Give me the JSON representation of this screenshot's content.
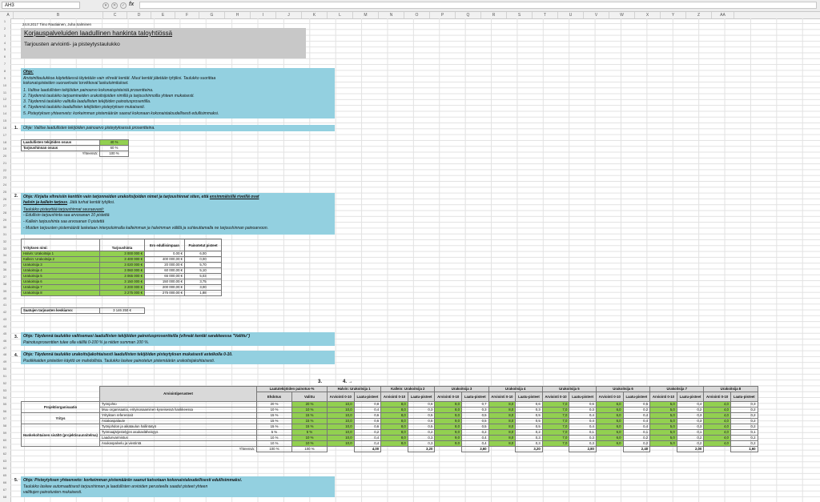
{
  "formula_bar": {
    "cell_ref": "AH3",
    "fx_label": "fx",
    "formula": ""
  },
  "column_letters": [
    "A",
    "B",
    "C",
    "D",
    "E",
    "F",
    "G",
    "H",
    "I",
    "J",
    "K",
    "L",
    "M",
    "N",
    "O",
    "P",
    "Q",
    "R",
    "S",
    "T",
    "U",
    "V",
    "W",
    "X",
    "Y",
    "Z",
    "AA"
  ],
  "row_numbers": [
    "1",
    "2",
    "3",
    "4",
    "5",
    "6",
    "7",
    "8",
    "9",
    "10",
    "11",
    "12",
    "13",
    "14",
    "15",
    "16",
    "17",
    "18",
    "19",
    "20",
    "21",
    "22",
    "23",
    "24",
    "25",
    "26",
    "27",
    "28",
    "29",
    "30",
    "31",
    "32",
    "33",
    "34",
    "35",
    "36",
    "37",
    "38",
    "39",
    "40",
    "41",
    "42",
    "43",
    "44",
    "45",
    "46",
    "47",
    "48",
    "49",
    "50",
    "51",
    "52",
    "53",
    "54",
    "55",
    "56",
    "57",
    "58",
    "59",
    "60",
    "61",
    "62",
    "63",
    "64",
    "65",
    "66",
    "67",
    "68"
  ],
  "doc": {
    "author_line": "24.8.2017 Timo Rautiainen, Juha Salminen",
    "title": "Korjauspalveluiden laadullinen hankinta taloyhtiössä",
    "subtitle": "Tarjousten arviointi- ja pisteytystaulukko"
  },
  "instructions": {
    "heading": "Ohje:",
    "line1": "Arviointitaulukkoa käytettäessä täytetään vain vihreät kentät. Muut kentät jätetään tyhjiksi. Taulukko suorittaa",
    "line2": "kokonaispisteiden suoraviivaisi torvikkoval laskutoimitukset.",
    "steps": [
      "1. Valitse laadullisten tekijöiden painoarvo kokonaispisteistä prosentteina.",
      "2. Täydennä taulukko tarjoamineiden urakoitsijoiden nimillä ja tarjoushinnoilla yhteen mukaisesti.",
      "3. Täydennä taulukko valitulla laadullisten tekijöiden painotusprosentilla.",
      "4. Täydennä taulukko laadullisten tekijöiden pisteytyksen mukaisesti.",
      "5. Pisteytyksen yhteenveto: korkeimman pistemäärän saanut kokonaan kokonaistaloudellisesti edullisimmaksi."
    ]
  },
  "section1": {
    "number": "1.",
    "text": "Ohje: Valitse laadullisten tekijöiden painoarvo pisteytyksessä prosentteina.",
    "rows": [
      {
        "label": "Laadullisten tekijöiden osuus",
        "value": "40 %"
      },
      {
        "label": "Tarjoushinnan osuus",
        "value": "60 %"
      },
      {
        "label": "Yhteensä:",
        "value": "100 %"
      }
    ]
  },
  "section2": {
    "number": "2.",
    "text1a": "Ohje: Kirjaita vihreisiin kenttiin vain tarjonneiden urakoitsijoiden nimet ja tarjoushinnat siten, että ",
    "text1b": "ensimmäisillä riveillä ovat",
    "text2a": "halvin ja kallein tarjous",
    "text2b": ". Jätä turhat kentät tyhjiksi.",
    "rules_heading": "Taulukko pisteyttää tarjoushinnat seuraavasti:",
    "rules": [
      "- Edullisin tarjoushinta saa arvosanan 10 pistettä",
      "- Kallein tarjoushinta saa arvosanan 0 pistettä",
      "- Muiden tarjousten pistemäärät lasketaan interpoloimalla kalleimman ja halvimman välillä ja suhteuttamalla ne tarjoushinnan painoarvoon."
    ],
    "headers": [
      "Yrityksen nimi:",
      "Tarjoushinta",
      "Ero edullisimpaan",
      "Painotetut pisteet"
    ],
    "rows": [
      [
        "Halvin: Urakoitsija 1",
        "3 000 000 €",
        "0,00 €",
        "6,00"
      ],
      [
        "Kallein: Urakoitsija 2",
        "3 400 000 €",
        "400 000,00 €",
        "0,00"
      ],
      [
        "Urakoitsija 3",
        "3 020 000 €",
        "20 000,00 €",
        "5,70"
      ],
      [
        "Urakoitsija 4",
        "3 060 000 €",
        "60 000,00 €",
        "5,10"
      ],
      [
        "Urakoitsija 5",
        "3 065 000 €",
        "65 000,00 €",
        "5,03"
      ],
      [
        "Urakoitsija 6",
        "3 150 000 €",
        "150 000,00 €",
        "3,75"
      ],
      [
        "Urakoitsija 7",
        "3 200 000 €",
        "200 000,00 €",
        "3,00"
      ],
      [
        "Urakoitsija 8",
        "3 275 000 €",
        "275 000,00 €",
        "1,88"
      ]
    ],
    "average_label": "Saatujen tarjousten keskiarvo:",
    "average_value": "3 146 250 €"
  },
  "section3": {
    "number": "3.",
    "text1": "Ohje: Täydennä taulukko valitsemasi laadullisten tekijöiden painotusprosentteilla (vihreät kentät sarakkeessa \"Valittu\")",
    "text2": "Painotusprosenttien tulee olla välillä 0-100 % ja niiden summan 100 %."
  },
  "section4": {
    "number": "4.",
    "text1": "Ohje: Täydennä taulukko urakoitsijakohtaisesti laadullisten tekijöiden pisteytyksen mukaisesti asteikolla 0-10.",
    "text2": "Puolikkaiden pisteiden käyttö on mahdollista. Taulukko laskee painotetun pistemäärän urakoitsijakohtaisesti."
  },
  "matrix": {
    "marker3": "3.",
    "marker4": "4. →",
    "crit_header": "Arviointiperusteet",
    "weights_header": "Laatutekijöiden painotus-%",
    "suggest_label": "Ehdotus",
    "chosen_label": "Valittu",
    "score_label": "Arviointi 0-10",
    "points_label": "Laatu-pisteet",
    "contractors": [
      "Halvin: Urakoitsija 1",
      "Kallein: Urakoitsija 2",
      "Urakoitsija 3",
      "Urakoitsija 4",
      "Urakoitsija 5",
      "Urakoitsija 6",
      "Urakoitsija 7",
      "Urakoitsija 8"
    ],
    "groups": [
      {
        "name": "Projektiorganisaatio",
        "span": 2
      },
      {
        "name": "Yritys",
        "span": 2
      },
      {
        "name": "Hankekohtainen sisältö (projektisuunnitelma)",
        "span": 4
      }
    ],
    "rows": [
      {
        "crit": "Työnjohto",
        "sug": "20 %",
        "sel": "20 %",
        "scores": [
          "10,0",
          "8,0",
          "9,0",
          "8,0",
          "7,0",
          "6,0",
          "5,0",
          "4,0"
        ],
        "pts": [
          "0,8",
          "0,6",
          "0,7",
          "0,6",
          "0,6",
          "0,5",
          "0,4",
          "0,3"
        ]
      },
      {
        "crit": "Muu organisaatio, erityisosaaminen kyseisessä hankkeessa",
        "sug": "10 %",
        "sel": "10 %",
        "scores": [
          "10,0",
          "8,0",
          "8,0",
          "8,0",
          "7,0",
          "6,0",
          "5,0",
          "4,0"
        ],
        "pts": [
          "0,4",
          "0,3",
          "0,3",
          "0,3",
          "0,3",
          "0,2",
          "0,2",
          "0,2"
        ]
      },
      {
        "crit": "Yrityksen referenssit",
        "sug": "15 %",
        "sel": "15 %",
        "scores": [
          "10,0",
          "8,0",
          "9,0",
          "8,0",
          "7,0",
          "6,0",
          "5,0",
          "4,0"
        ],
        "pts": [
          "0,6",
          "0,5",
          "0,5",
          "0,5",
          "0,4",
          "0,4",
          "0,3",
          "0,2"
        ]
      },
      {
        "crit": "Asiakaspalaute",
        "sug": "15 %",
        "sel": "15 %",
        "scores": [
          "10,0",
          "8,0",
          "9,0",
          "8,0",
          "7,0",
          "6,0",
          "5,0",
          "4,0"
        ],
        "pts": [
          "0,6",
          "0,5",
          "0,5",
          "0,5",
          "0,4",
          "0,4",
          "0,3",
          "0,2"
        ]
      },
      {
        "crit": "Työnjohdon ja aikataulun hallintatyö",
        "sug": "15 %",
        "sel": "15 %",
        "scores": [
          "10,0",
          "8,0",
          "8,0",
          "8,0",
          "7,0",
          "6,0",
          "5,0",
          "4,0"
        ],
        "pts": [
          "0,6",
          "0,5",
          "0,5",
          "0,5",
          "0,4",
          "0,4",
          "0,3",
          "0,2"
        ]
      },
      {
        "crit": "Työmaajärjestelyjen asukasläheisyys",
        "sug": "5 %",
        "sel": "5 %",
        "scores": [
          "10,0",
          "8,0",
          "9,0",
          "8,0",
          "7,0",
          "6,0",
          "5,0",
          "4,0"
        ],
        "pts": [
          "0,2",
          "0,2",
          "0,2",
          "0,2",
          "0,1",
          "0,1",
          "0,1",
          "0,1"
        ]
      },
      {
        "crit": "Laadunvarmistus",
        "sug": "10 %",
        "sel": "10 %",
        "scores": [
          "10,0",
          "8,0",
          "9,0",
          "8,0",
          "7,0",
          "6,0",
          "5,0",
          "4,0"
        ],
        "pts": [
          "0,4",
          "0,3",
          "0,4",
          "0,3",
          "0,3",
          "0,2",
          "0,2",
          "0,2"
        ]
      },
      {
        "crit": "Asukaspalvelu ja viestintä",
        "sug": "10 %",
        "sel": "10 %",
        "scores": [
          "10,0",
          "8,0",
          "9,0",
          "8,0",
          "7,0",
          "6,0",
          "5,0",
          "4,0"
        ],
        "pts": [
          "0,4",
          "0,3",
          "0,4",
          "0,3",
          "0,3",
          "0,2",
          "0,2",
          "0,2"
        ]
      }
    ],
    "total_label": "Yhteensä:",
    "total_sug": "100 %",
    "total_sel": "100 %",
    "totals": [
      "4,00",
      "3,20",
      "3,60",
      "3,20",
      "2,80",
      "2,40",
      "2,00",
      "1,60"
    ]
  },
  "section5": {
    "number": "5.",
    "text1": "Ohje: Pisteytyksen yhteenveto: korkeimman pistemäärän saanut katsotaan kokonaistaloudellisesti edullisimmaksi.",
    "text2": "Taulukko laskee automaattisesti tarjoushinnan ja laadullisten arvioiden perusteella saadut pisteet yhteen",
    "text3": "valittujen painotusten mukaisesti."
  },
  "colors": {
    "green": "#92d050",
    "blue": "#93d0e0",
    "title_gray": "#c8c8c8"
  }
}
